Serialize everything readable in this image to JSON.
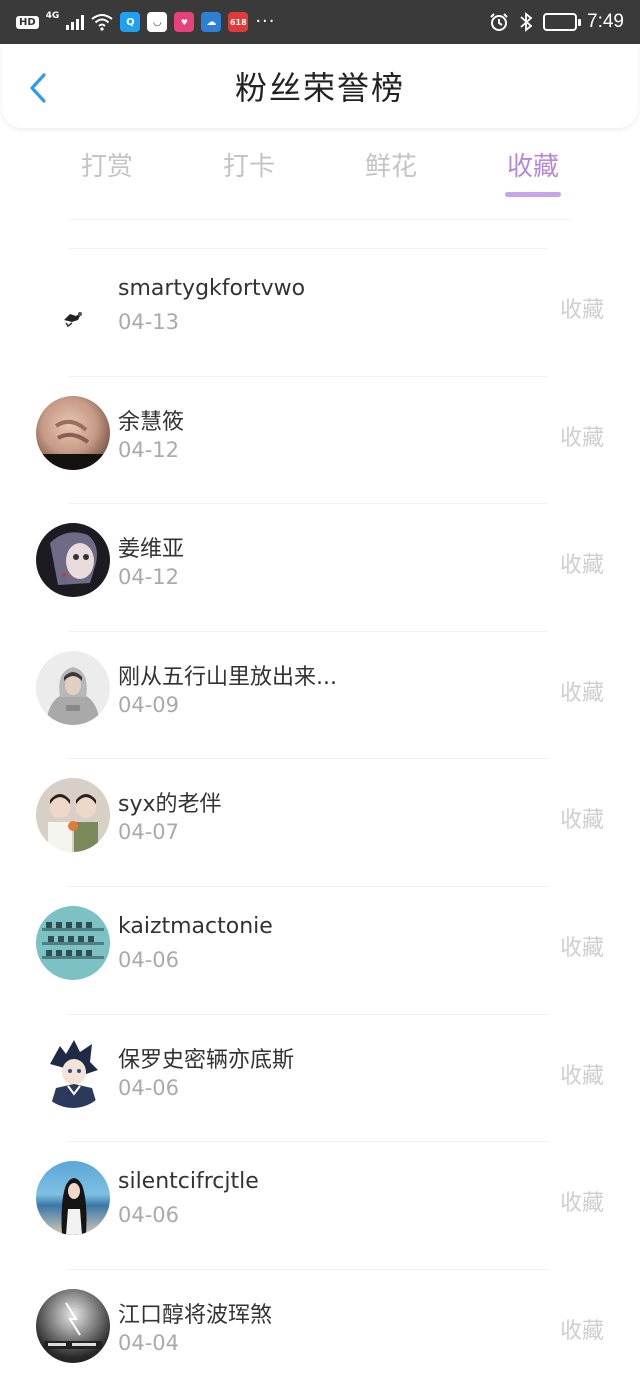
{
  "status_bar": {
    "hd": "HD",
    "network": "4G",
    "time": "7:49",
    "dots": "···",
    "app_icons": [
      {
        "name": "search-app-icon",
        "color": "#1da1f2",
        "glyph": "Q"
      },
      {
        "name": "shop-app-icon",
        "color": "#ffffff",
        "glyph": ""
      },
      {
        "name": "promo-app-icon",
        "color": "#e8407a",
        "glyph": ""
      },
      {
        "name": "cloud-app-icon",
        "color": "#2d7fd8",
        "glyph": ""
      },
      {
        "name": "sale-618-app-icon",
        "color": "#e23a3a",
        "glyph": "618"
      }
    ]
  },
  "header": {
    "title": "粉丝荣誉榜"
  },
  "tabs": [
    {
      "label": "打赏",
      "active": false
    },
    {
      "label": "打卡",
      "active": false
    },
    {
      "label": "鲜花",
      "active": false
    },
    {
      "label": "收藏",
      "active": true
    }
  ],
  "list": [
    {
      "name": "smartygkfortvwo",
      "date": "04-13",
      "action": "收藏",
      "avatar": "bird"
    },
    {
      "name": "余慧筱",
      "date": "04-12",
      "action": "收藏",
      "avatar": "hand"
    },
    {
      "name": "姜维亚",
      "date": "04-12",
      "action": "收藏",
      "avatar": "portrait-dark"
    },
    {
      "name": "刚从五行山里放出来...",
      "date": "04-09",
      "action": "收藏",
      "avatar": "hoodie"
    },
    {
      "name": "syx的老伴",
      "date": "04-07",
      "action": "收藏",
      "avatar": "group"
    },
    {
      "name": "kaiztmactonie",
      "date": "04-06",
      "action": "收藏",
      "avatar": "shelves"
    },
    {
      "name": "保罗史密辆亦底斯",
      "date": "04-06",
      "action": "收藏",
      "avatar": "anime"
    },
    {
      "name": "silentcifrcjtle",
      "date": "04-06",
      "action": "收藏",
      "avatar": "sea"
    },
    {
      "name": "江口醇将波珲煞",
      "date": "04-04",
      "action": "收藏",
      "avatar": "bw"
    }
  ],
  "colors": {
    "accent": "#b58ad8",
    "underline": "#c8a4e8",
    "back_arrow": "#2f9bea",
    "inactive_tab": "#c4c4c4",
    "muted_action": "#cfcfcf"
  }
}
